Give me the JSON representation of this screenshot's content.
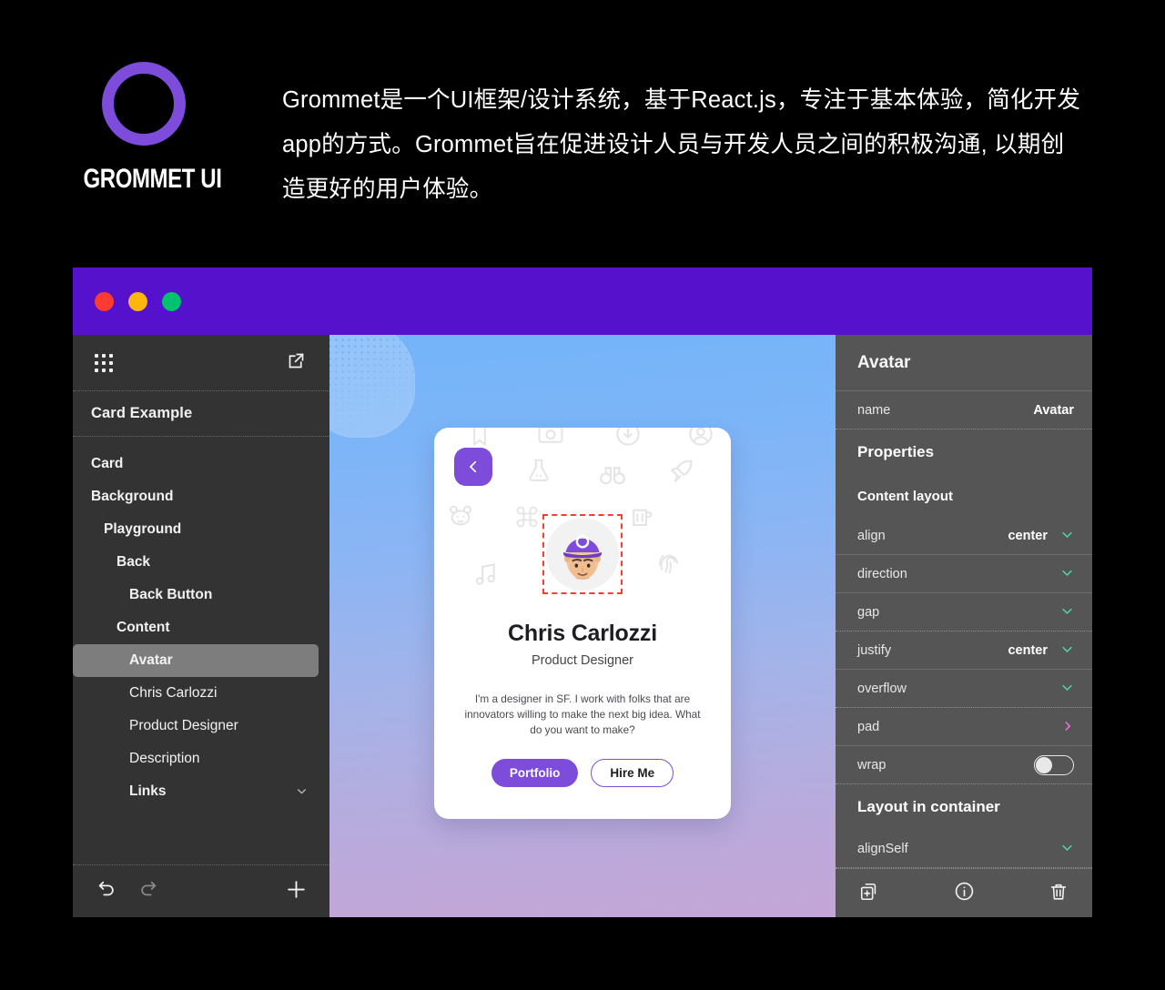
{
  "header": {
    "logo_text": "GROMMET UI",
    "paragraph": "Grommet是一个UI框架/设计系统，基于React.js，专注于基本体验，简化开发app的方式。Grommet旨在促进设计人员与开发人员之间的积极沟通, 以期创造更好的用户体验。"
  },
  "colors": {
    "brand_purple": "#7d4cdb",
    "titlebar_purple": "#5511cc",
    "sidebar_bg": "#333333",
    "props_bg": "#555555",
    "selection_red": "#ff3b30",
    "chevron_green": "#4ddba0",
    "chevron_pink": "#e86bd9",
    "traffic_red": "#fd3b30",
    "traffic_amber": "#fdb60d",
    "traffic_green": "#00c16e"
  },
  "titlebar": {
    "close_label": "close",
    "minimize_label": "minimize",
    "maximize_label": "maximize"
  },
  "sidebar": {
    "grid_icon": "apps-grid-icon",
    "external_icon": "external-link-icon",
    "title": "Card Example",
    "tree": [
      {
        "label": "Card",
        "depth": 0,
        "bold": true,
        "selected": false,
        "chevron": false
      },
      {
        "label": "Background",
        "depth": 0,
        "bold": true,
        "selected": false,
        "chevron": false
      },
      {
        "label": "Playground",
        "depth": 1,
        "bold": true,
        "selected": false,
        "chevron": false
      },
      {
        "label": "Back",
        "depth": 2,
        "bold": true,
        "selected": false,
        "chevron": false
      },
      {
        "label": "Back Button",
        "depth": 3,
        "bold": true,
        "selected": false,
        "chevron": false
      },
      {
        "label": "Content",
        "depth": 2,
        "bold": true,
        "selected": false,
        "chevron": false
      },
      {
        "label": "Avatar",
        "depth": 3,
        "bold": true,
        "selected": true,
        "chevron": false
      },
      {
        "label": "Chris Carlozzi",
        "depth": 3,
        "bold": false,
        "selected": false,
        "chevron": false
      },
      {
        "label": "Product Designer",
        "depth": 3,
        "bold": false,
        "selected": false,
        "chevron": false
      },
      {
        "label": "Description",
        "depth": 3,
        "bold": false,
        "selected": false,
        "chevron": false
      },
      {
        "label": "Links",
        "depth": 3,
        "bold": true,
        "selected": false,
        "chevron": true
      }
    ],
    "footer": {
      "undo": "undo-icon",
      "redo": "redo-icon",
      "add": "add-icon"
    }
  },
  "card": {
    "back_icon": "chevron-left-icon",
    "avatar_alt": "avatar-illustration",
    "name": "Chris Carlozzi",
    "role": "Product Designer",
    "description": "I'm a designer in SF. I work with folks that are innovators willing to make the next big idea. What do you want to make?",
    "primary_button": "Portfolio",
    "secondary_button": "Hire Me",
    "decorative_icons": [
      "bookmark-icon",
      "camera-icon",
      "download-circle-icon",
      "user-circle-icon",
      "flask-icon",
      "binoculars-icon",
      "rocket-icon",
      "bear-icon",
      "command-icon",
      "beer-mug-icon",
      "music-note-icon",
      "fingerprint-icon"
    ]
  },
  "properties": {
    "title": "Avatar",
    "name_row": {
      "key": "name",
      "value": "Avatar"
    },
    "properties_heading": "Properties",
    "content_layout_heading": "Content layout",
    "rows": [
      {
        "key": "align",
        "value": "center",
        "control": "chevron-green"
      },
      {
        "key": "direction",
        "value": "",
        "control": "chevron-green"
      },
      {
        "key": "gap",
        "value": "",
        "control": "chevron-green"
      },
      {
        "key": "justify",
        "value": "center",
        "control": "chevron-green"
      },
      {
        "key": "overflow",
        "value": "",
        "control": "chevron-green"
      },
      {
        "key": "pad",
        "value": "",
        "control": "chevron-pink"
      },
      {
        "key": "wrap",
        "value": "",
        "control": "toggle-off"
      }
    ],
    "layout_heading": "Layout in container",
    "layout_rows": [
      {
        "key": "alignSelf",
        "value": "",
        "control": "chevron-green"
      }
    ],
    "footer": {
      "duplicate": "duplicate-icon",
      "info": "info-icon",
      "delete": "trash-icon"
    }
  }
}
